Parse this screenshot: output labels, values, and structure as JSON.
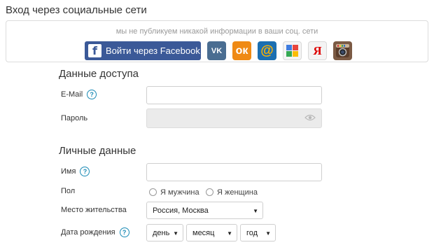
{
  "social": {
    "title": "Вход через социальные сети",
    "notice": "мы не публикуем никакой информации в ваши соц. сети",
    "facebook_label": "Войти через Facebook",
    "facebook_glyph": "f",
    "vk_glyph": "VK",
    "ok_glyph": "ок",
    "mail_glyph": "@",
    "yandex_glyph": "Я",
    "icons": [
      "facebook-icon",
      "vk-icon",
      "odnoklassniki-icon",
      "mailru-icon",
      "google-icon",
      "yandex-icon",
      "instagram-icon"
    ]
  },
  "access": {
    "title": "Данные доступа",
    "email_label": "E-Mail",
    "email_value": "",
    "password_label": "Пароль",
    "password_value": ""
  },
  "personal": {
    "title": "Личные данные",
    "name_label": "Имя",
    "name_value": "",
    "gender_label": "Пол",
    "gender_options": [
      "Я мужчина",
      "Я женщина"
    ],
    "location_label": "Место жительства",
    "location_value": "Россия, Москва",
    "birth_label": "Дата рождения",
    "birth_day": "день",
    "birth_month": "месяц",
    "birth_year": "год"
  },
  "help_glyph": "?",
  "colors": {
    "facebook": "#3b5998",
    "vk": "#4a6d91",
    "ok": "#ef8a14",
    "mail": "#1c6fb1",
    "help": "#1a8ab5"
  }
}
